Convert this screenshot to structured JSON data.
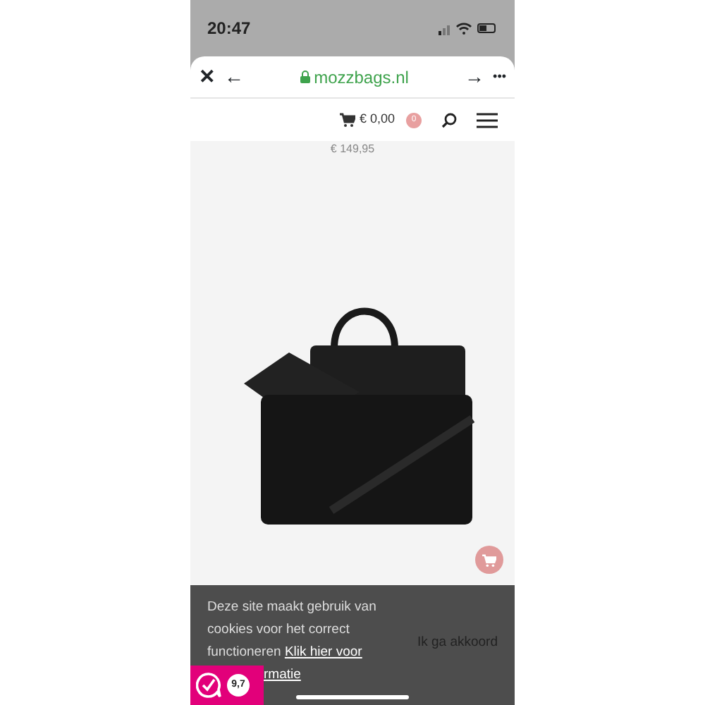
{
  "status_bar": {
    "time": "20:47"
  },
  "browser_bar": {
    "close": "✕",
    "back": "←",
    "domain": "mozzbags.nl",
    "forward": "→",
    "more": "•••"
  },
  "site_header": {
    "cart_total": "€ 0,00",
    "cart_count": "0"
  },
  "product": {
    "price": "€ 149,95"
  },
  "cookie_bar": {
    "message": "Deze site maakt gebruik van cookies voor het correct functioneren ",
    "link": "Klik hier voor",
    "link_tail": "rmatie",
    "accept": "Ik ga akkoord"
  },
  "rating_badge": {
    "score": "9,7"
  }
}
